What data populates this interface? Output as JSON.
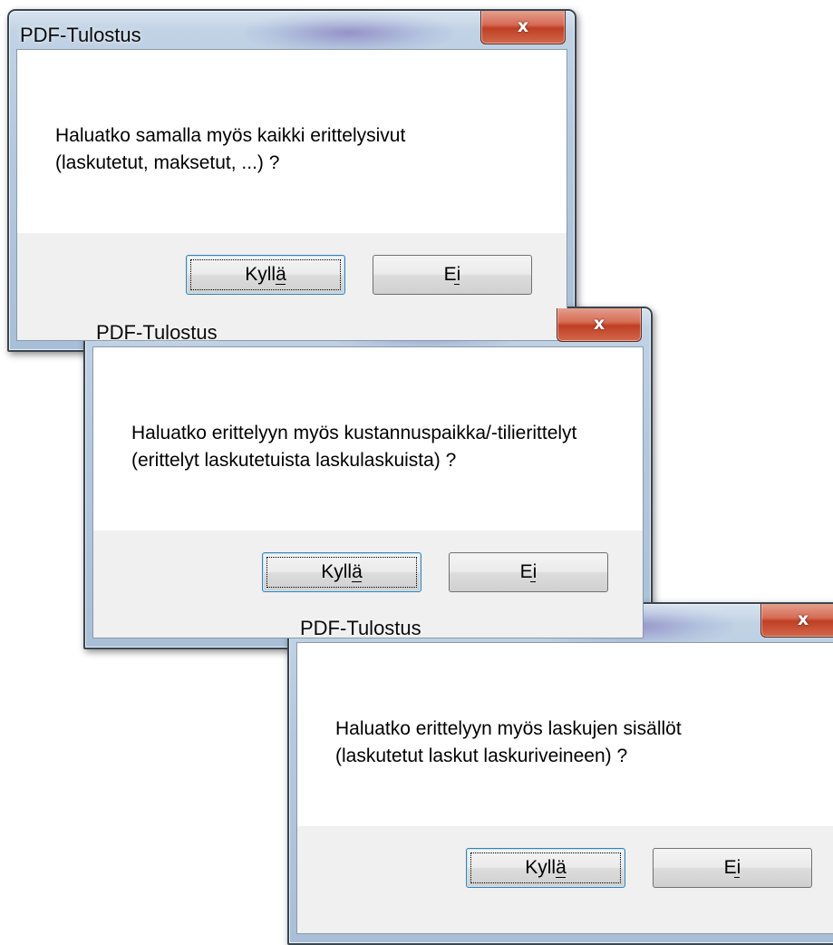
{
  "dialogs": [
    {
      "title": "PDF-Tulostus",
      "close_symbol": "x",
      "message_lines": [
        "Haluatko samalla myös kaikki erittelysivut",
        "(laskutetut, maksetut, ...) ?"
      ],
      "yes_label": "Kyllä",
      "no_label": "Ei"
    },
    {
      "title": "PDF-Tulostus",
      "close_symbol": "x",
      "message_lines": [
        "Haluatko erittelyyn myös kustannuspaikka/-tilierittelyt",
        "(erittelyt laskutetuista laskulaskuista) ?"
      ],
      "yes_label": "Kyllä",
      "no_label": "Ei"
    },
    {
      "title": "PDF-Tulostus",
      "close_symbol": "x",
      "message_lines": [
        "Haluatko erittelyyn myös laskujen sisällöt",
        "(laskutetut laskut laskuriveineen) ?"
      ],
      "yes_label": "Kyllä",
      "no_label": "Ei"
    }
  ],
  "icons": {
    "close": "close-icon"
  },
  "colors": {
    "window_frame": "#b6c9de",
    "close_button": "#c94a30",
    "dialog_face": "#f0f0f0",
    "content_bg": "#ffffff"
  }
}
